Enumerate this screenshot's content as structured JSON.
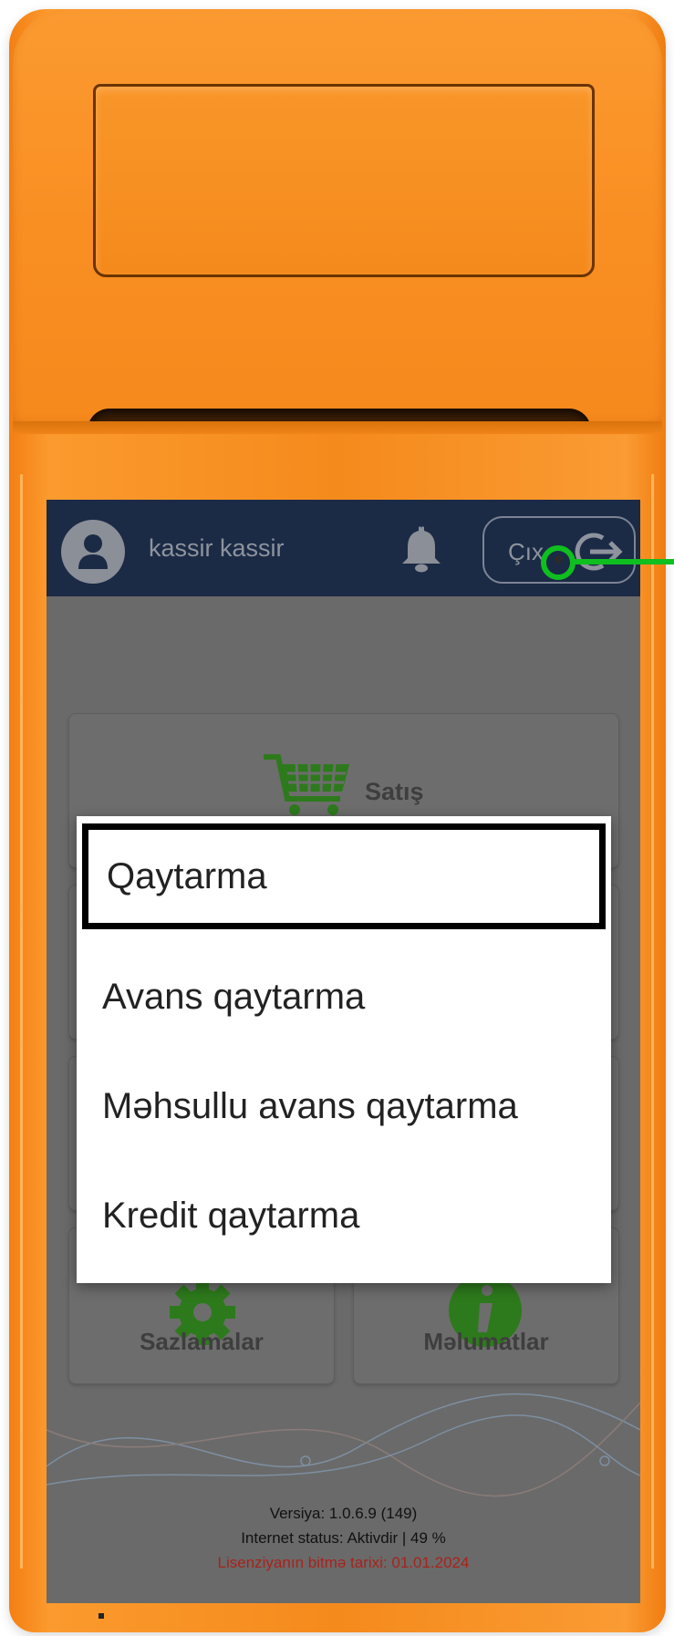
{
  "header": {
    "username": "kassir kassir",
    "logout_label": "Çıx",
    "bg_color": "#1b2a45"
  },
  "dashboard": {
    "tiles": [
      {
        "label": "Satış",
        "icon": "shopping-cart-icon"
      },
      {
        "label": "Sazlamalar",
        "icon": "gear-icon"
      },
      {
        "label": "Məlumatlar",
        "icon": "info-icon"
      }
    ]
  },
  "menu": {
    "items": [
      {
        "label": "Qaytarma"
      },
      {
        "label": "Avans qaytarma"
      },
      {
        "label": "Məhsullu avans qaytarma"
      },
      {
        "label": "Kredit qaytarma"
      }
    ]
  },
  "footer": {
    "version": "Versiya: 1.0.6.9 (149)",
    "internet_status": "Internet status: Aktivdir | 49 %",
    "license": "Lisenziyanın bitmə tarixi: 01.01.2024"
  },
  "colors": {
    "device_orange": "#f58a1c",
    "accent_green": "#2d8a1e",
    "click_marker": "#0fbe1f",
    "license_red": "#a8231b"
  }
}
